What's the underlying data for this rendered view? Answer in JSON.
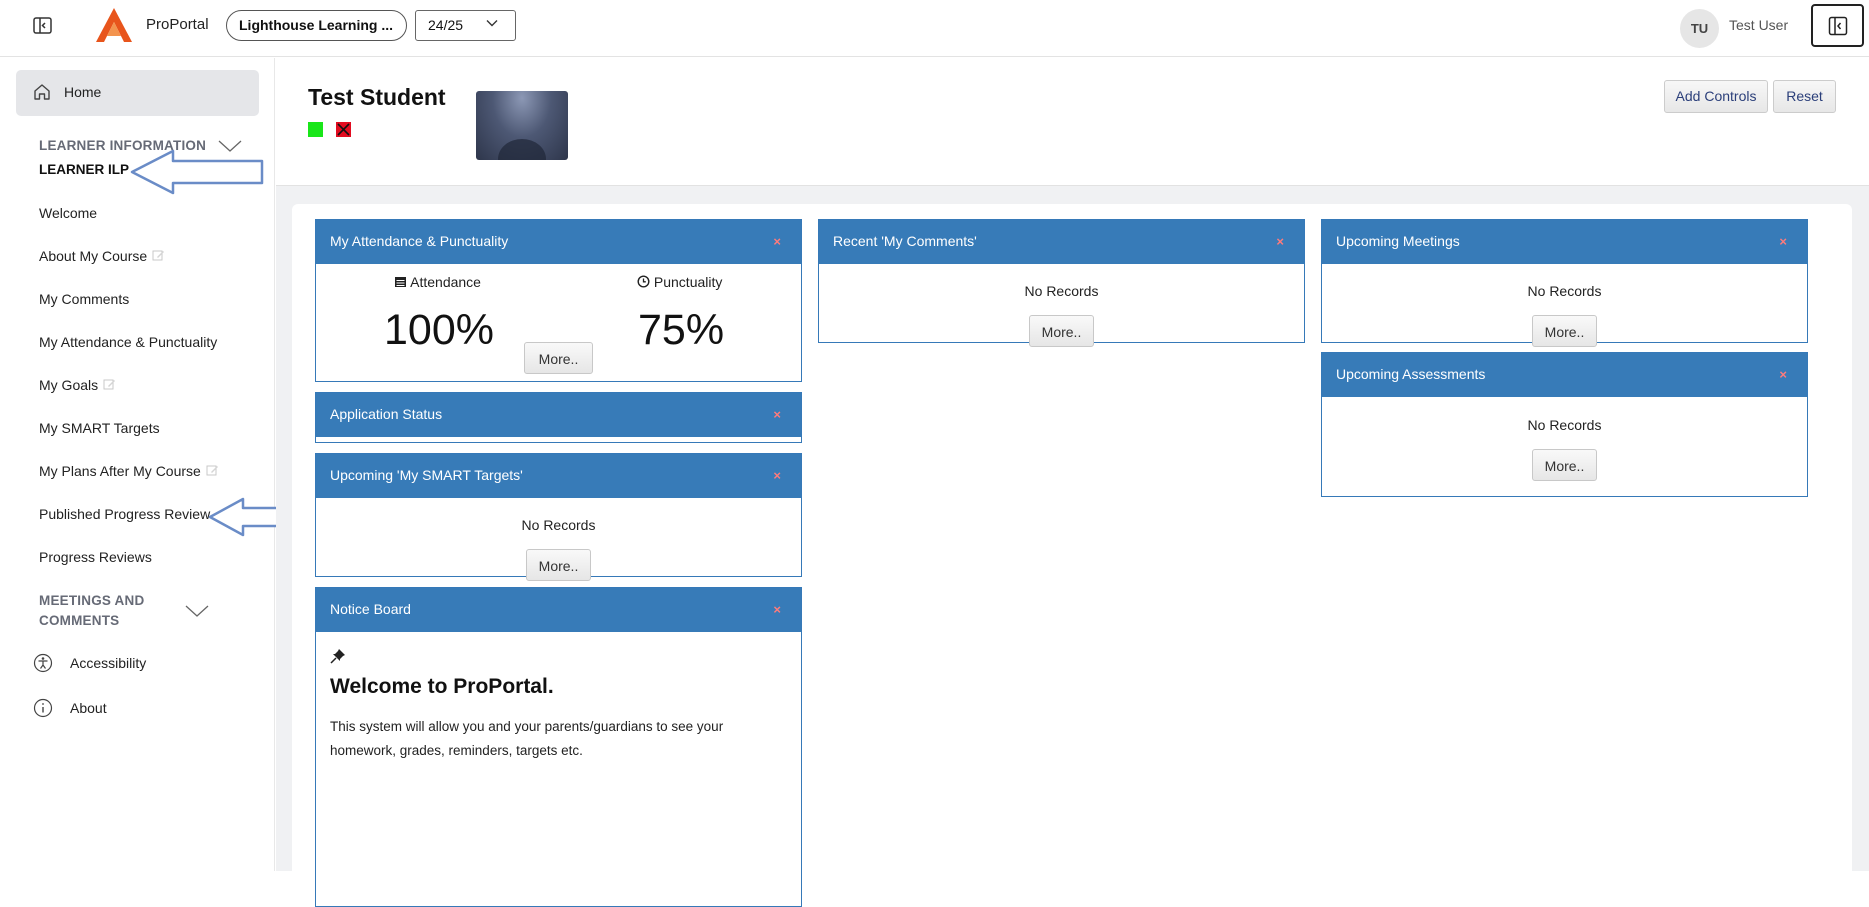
{
  "topbar": {
    "brand": "ProPortal",
    "school": "Lighthouse Learning ...",
    "year": "24/25",
    "user_initials": "TU",
    "user_name": "Test User",
    "accent_color": "#e8551c"
  },
  "sidebar": {
    "home": "Home",
    "section_learner": "LEARNER INFORMATION",
    "items": [
      {
        "label": "LEARNER ILP",
        "icon": null
      },
      {
        "label": "Welcome",
        "icon": null
      },
      {
        "label": "About My Course",
        "icon": "edit-icon"
      },
      {
        "label": "My Comments",
        "icon": null
      },
      {
        "label": "My Attendance & Punctuality",
        "icon": null
      },
      {
        "label": "My Goals",
        "icon": "edit-icon"
      },
      {
        "label": "My SMART Targets",
        "icon": null
      },
      {
        "label": "My Plans After My Course",
        "icon": "edit-icon"
      },
      {
        "label": "Published Progress Review",
        "icon": null
      },
      {
        "label": "Progress Reviews",
        "icon": null
      }
    ],
    "section_meetings_line1": "MEETINGS AND",
    "section_meetings_line2": "COMMENTS",
    "accessibility": "Accessibility",
    "about": "About"
  },
  "student": {
    "name": "Test Student",
    "flag_colors": [
      "#19e619",
      "#e20c20"
    ]
  },
  "header_buttons": {
    "add_controls": "Add Controls",
    "reset": "Reset"
  },
  "widgets": {
    "attendance": {
      "title": "My Attendance & Punctuality",
      "attendance_label": "Attendance",
      "attendance_value": "100%",
      "punctuality_label": "Punctuality",
      "punctuality_value": "75%",
      "more": "More..",
      "close": "×"
    },
    "application_status": {
      "title": "Application Status",
      "close": "×"
    },
    "smart_targets": {
      "title": "Upcoming 'My SMART Targets'",
      "empty": "No Records",
      "more": "More..",
      "close": "×"
    },
    "notice_board": {
      "title": "Notice Board",
      "close": "×",
      "heading": "Welcome to ProPortal.",
      "body": "This system will allow you and your parents/guardians to see your homework, grades, reminders, targets etc."
    },
    "recent_comments": {
      "title": "Recent 'My Comments'",
      "empty": "No Records",
      "more": "More..",
      "close": "×"
    },
    "upcoming_meetings": {
      "title": "Upcoming Meetings",
      "empty": "No Records",
      "more": "More..",
      "close": "×"
    },
    "upcoming_assessments": {
      "title": "Upcoming Assessments",
      "empty": "No Records",
      "more": "More..",
      "close": "×"
    }
  },
  "colors": {
    "widget_header": "#377bb8",
    "annotation_arrow": "#6a8cc7"
  }
}
